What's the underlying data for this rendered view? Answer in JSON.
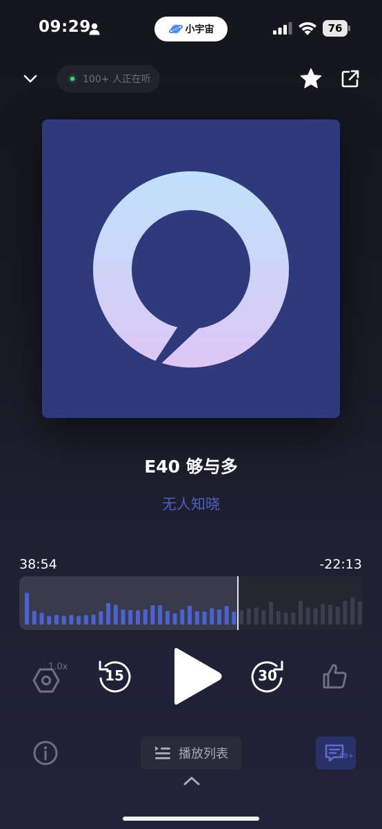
{
  "status_bar": {
    "time": "09:29",
    "app_pill_label": "小宇宙",
    "battery": "76",
    "icons": [
      "person-icon",
      "planet-icon",
      "signal-icon",
      "wifi-icon",
      "battery-icon"
    ]
  },
  "header": {
    "listeners": "100+ 人正在听",
    "live_color": "#3fd67a",
    "icons": [
      "chevron-down-icon",
      "star-icon",
      "share-icon"
    ]
  },
  "cover": {
    "background": "#2f3a7c",
    "gradient_top": "#bfe2fb",
    "gradient_bottom": "#ddc6f5",
    "icon": "logo-ring-icon"
  },
  "episode": {
    "title": "E40 够与多",
    "author": "无人知晓",
    "author_color": "#4d5fc0"
  },
  "player": {
    "elapsed": "38:54",
    "remaining": "-22:13",
    "progress": 0.6365,
    "waveform_played_color": "#4c63cf",
    "waveform_remaining_color": "#3d3e4c",
    "waveform_levels": [
      0.74,
      0.32,
      0.27,
      0.2,
      0.22,
      0.2,
      0.22,
      0.2,
      0.22,
      0.23,
      0.31,
      0.5,
      0.46,
      0.35,
      0.34,
      0.33,
      0.35,
      0.45,
      0.45,
      0.32,
      0.26,
      0.35,
      0.44,
      0.31,
      0.3,
      0.38,
      0.35,
      0.43,
      0.3,
      0.33,
      0.38,
      0.4,
      0.33,
      0.53,
      0.32,
      0.28,
      0.28,
      0.55,
      0.4,
      0.38,
      0.48,
      0.46,
      0.42,
      0.55,
      0.63,
      0.54
    ],
    "speed": "1.0x",
    "rewind_seconds": "15",
    "forward_seconds": "30",
    "icons": [
      "speed-icon",
      "rewind-icon",
      "play-icon",
      "forward-icon",
      "thumbs-up-icon"
    ]
  },
  "bottom": {
    "playlist_label": "播放列表",
    "comments_badge": "99+",
    "icons": [
      "info-icon",
      "playlist-icon",
      "comment-icon",
      "chevron-up-icon"
    ]
  }
}
